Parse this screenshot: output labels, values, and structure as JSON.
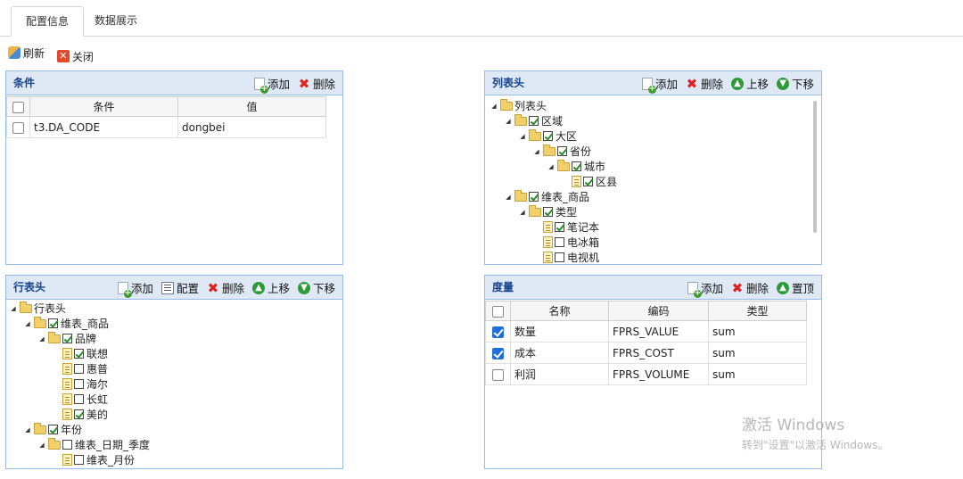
{
  "tabs": [
    "配置信息",
    "数据展示"
  ],
  "toolbar": {
    "refresh": "刷新",
    "close": "关闭"
  },
  "conditions": {
    "title": "条件",
    "add": "添加",
    "del": "删除",
    "headers": [
      "条件",
      "值"
    ],
    "rows": [
      {
        "checked": false,
        "cond": "t3.DA_CODE",
        "value": "dongbei"
      }
    ]
  },
  "columns": {
    "title": "列表头",
    "add": "添加",
    "del": "删除",
    "up": "上移",
    "down": "下移",
    "tree": [
      {
        "label": "列表头",
        "depth": 0,
        "type": "folder",
        "check": null
      },
      {
        "label": "区域",
        "depth": 1,
        "type": "folder",
        "check": true
      },
      {
        "label": "大区",
        "depth": 2,
        "type": "folder",
        "check": true
      },
      {
        "label": "省份",
        "depth": 3,
        "type": "folder",
        "check": true
      },
      {
        "label": "城市",
        "depth": 4,
        "type": "folder",
        "check": true
      },
      {
        "label": "区县",
        "depth": 5,
        "type": "leaf",
        "check": true
      },
      {
        "label": "维表_商品",
        "depth": 1,
        "type": "folder",
        "check": true
      },
      {
        "label": "类型",
        "depth": 2,
        "type": "folder",
        "check": true
      },
      {
        "label": "笔记本",
        "depth": 3,
        "type": "leaf",
        "check": true
      },
      {
        "label": "电冰箱",
        "depth": 3,
        "type": "leaf",
        "check": false
      },
      {
        "label": "电视机",
        "depth": 3,
        "type": "leaf",
        "check": false
      }
    ]
  },
  "rows": {
    "title": "行表头",
    "add": "添加",
    "cfg": "配置",
    "del": "删除",
    "up": "上移",
    "down": "下移",
    "tree": [
      {
        "label": "行表头",
        "depth": 0,
        "type": "folder",
        "check": null
      },
      {
        "label": "维表_商品",
        "depth": 1,
        "type": "folder",
        "check": true
      },
      {
        "label": "品牌",
        "depth": 2,
        "type": "folder",
        "check": true
      },
      {
        "label": "联想",
        "depth": 3,
        "type": "leaf",
        "check": true
      },
      {
        "label": "惠普",
        "depth": 3,
        "type": "leaf",
        "check": false
      },
      {
        "label": "海尔",
        "depth": 3,
        "type": "leaf",
        "check": false
      },
      {
        "label": "长虹",
        "depth": 3,
        "type": "leaf",
        "check": false
      },
      {
        "label": "美的",
        "depth": 3,
        "type": "leaf",
        "check": true
      },
      {
        "label": "年份",
        "depth": 1,
        "type": "folder",
        "check": true
      },
      {
        "label": "维表_日期_季度",
        "depth": 2,
        "type": "folder",
        "check": false
      },
      {
        "label": "维表_月份",
        "depth": 3,
        "type": "leaf",
        "check": false
      }
    ]
  },
  "measures": {
    "title": "度量",
    "add": "添加",
    "del": "删除",
    "top": "置顶",
    "headers": [
      "名称",
      "编码",
      "类型"
    ],
    "rows": [
      {
        "checked": true,
        "name": "数量",
        "code": "FPRS_VALUE",
        "type": "sum"
      },
      {
        "checked": true,
        "name": "成本",
        "code": "FPRS_COST",
        "type": "sum"
      },
      {
        "checked": false,
        "name": "利润",
        "code": "FPRS_VOLUME",
        "type": "sum"
      }
    ]
  },
  "watermark": {
    "line1": "激活 Windows",
    "line2": "转到\"设置\"以激活 Windows。"
  }
}
